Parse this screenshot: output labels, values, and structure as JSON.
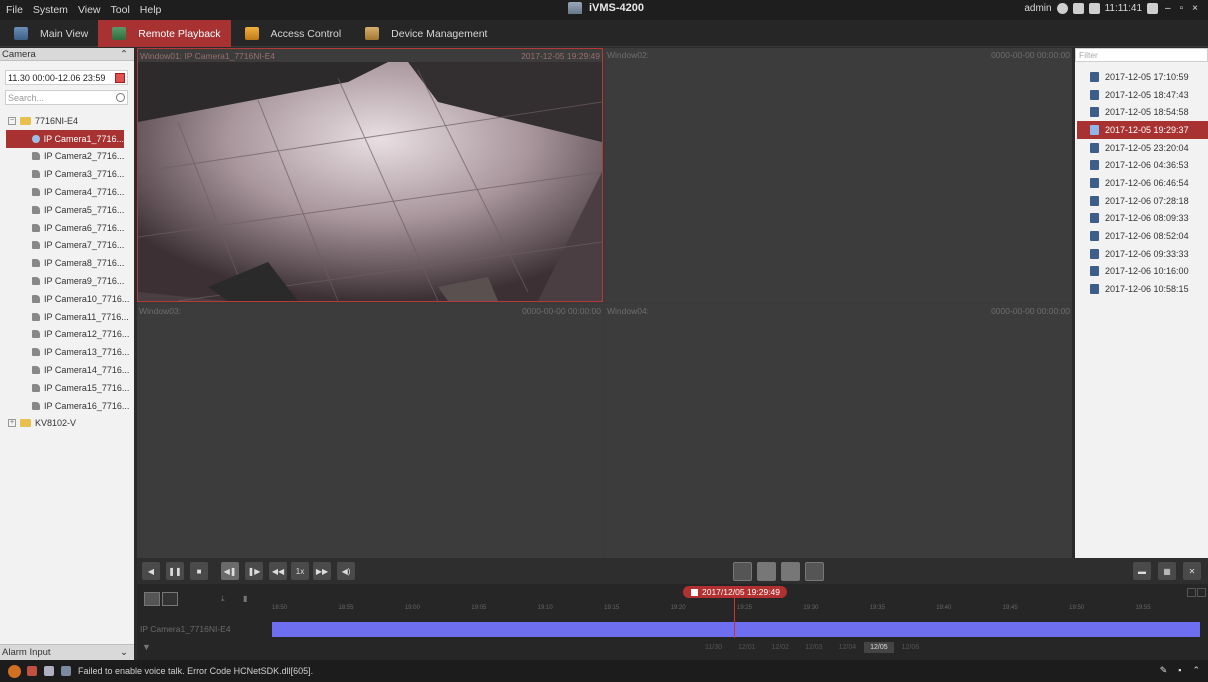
{
  "menu": [
    "File",
    "System",
    "View",
    "Tool",
    "Help"
  ],
  "app_title": "iVMS-4200",
  "topbar": {
    "user": "admin",
    "clock": "11:11:41"
  },
  "tabs": [
    {
      "label": "Main View"
    },
    {
      "label": "Remote Playback"
    },
    {
      "label": "Access Control"
    },
    {
      "label": "Device Management"
    }
  ],
  "left_panel": {
    "title": "Camera",
    "date_range": "11.30 00:00-12.06 23:59",
    "search_placeholder": "Search...",
    "groups": [
      {
        "name": "7716NI-E4"
      },
      {
        "name": "KV8102-V"
      }
    ],
    "cameras": [
      "IP Camera1_7716...",
      "IP Camera2_7716...",
      "IP Camera3_7716...",
      "IP Camera4_7716...",
      "IP Camera5_7716...",
      "IP Camera6_7716...",
      "IP Camera7_7716...",
      "IP Camera8_7716...",
      "IP Camera9_7716...",
      "IP Camera10_7716...",
      "IP Camera11_7716...",
      "IP Camera12_7716...",
      "IP Camera13_7716...",
      "IP Camera14_7716...",
      "IP Camera15_7716...",
      "IP Camera16_7716..."
    ],
    "alarm_input": "Alarm Input"
  },
  "windows": [
    {
      "name": "Window01: IP Camera1_7716NI-E4",
      "time": "2017-12-05 19:29:49"
    },
    {
      "name": "Window02:",
      "time": "0000-00-00 00:00:00"
    },
    {
      "name": "Window03:",
      "time": "0000-00-00 00:00:00"
    },
    {
      "name": "Window04:",
      "time": "0000-00-00 00:00:00"
    }
  ],
  "right_panel": {
    "filter_placeholder": "Filter",
    "records": [
      "2017-12-05 17:10:59",
      "2017-12-05 18:47:43",
      "2017-12-05 18:54:58",
      "2017-12-05 19:29:37",
      "2017-12-05 23:20:04",
      "2017-12-06 04:36:53",
      "2017-12-06 06:46:54",
      "2017-12-06 07:28:18",
      "2017-12-06 08:09:33",
      "2017-12-06 08:52:04",
      "2017-12-06 09:33:33",
      "2017-12-06 10:16:00",
      "2017-12-06 10:58:15"
    ],
    "selected_index": 3
  },
  "controls": {
    "speed": "1x"
  },
  "timeline": {
    "current_time": "2017/12/05 19:29:49",
    "track_label": "IP Camera1_7716NI-E4",
    "ticks": [
      "18:50",
      "18:55",
      "19:00",
      "19:05",
      "19:10",
      "19:15",
      "19:20",
      "19:25",
      "19:30",
      "19:35",
      "19:40",
      "19:45",
      "19:50",
      "19:55"
    ],
    "dates": [
      "11/30",
      "12/01",
      "12/02",
      "12/03",
      "12/04",
      "12/05",
      "12/06"
    ],
    "active_date_index": 5
  },
  "status": {
    "message": "Failed to enable voice talk. Error Code HCNetSDK.dll[605]."
  },
  "colors": {
    "accent": "#a83232",
    "timeline_bar": "#6e6ef0"
  }
}
